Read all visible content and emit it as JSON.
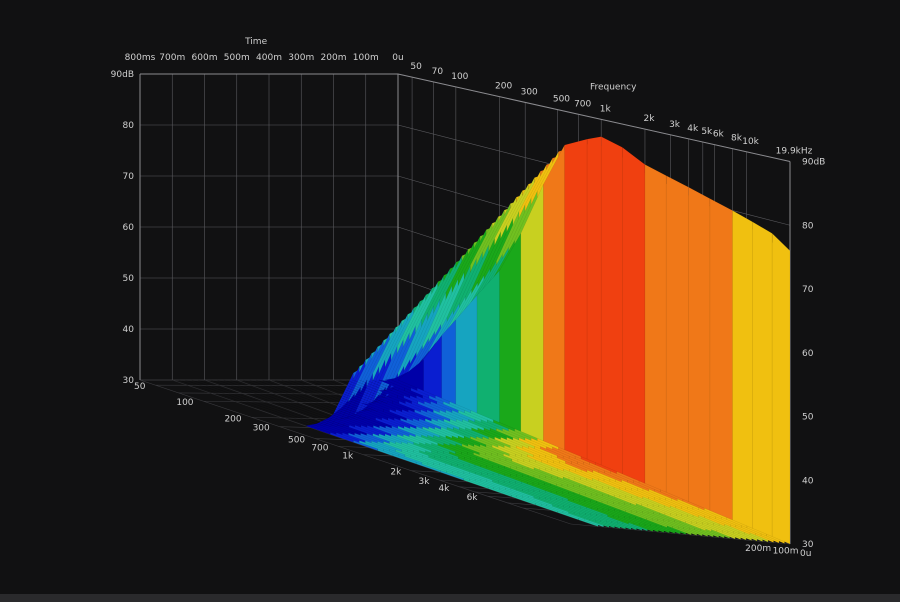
{
  "chart_data": {
    "type": "waterfall-3d",
    "title": "",
    "axes": {
      "time": {
        "label": "Time",
        "ticks": [
          "800ms",
          "700m",
          "600m",
          "500m",
          "400m",
          "300m",
          "200m",
          "100m",
          "0u"
        ]
      },
      "frequency": {
        "label": "Frequency",
        "back_ticks": [
          "50",
          "70",
          "100",
          "200",
          "300",
          "500",
          "700",
          "1k",
          "2k",
          "3k",
          "4k",
          "5k",
          "6k",
          "8k",
          "10k",
          "19.9kHz"
        ],
        "side_ticks": [
          "50",
          "100",
          "200",
          "300",
          "500",
          "700",
          "1k",
          "2k",
          "3k",
          "4k",
          "6k"
        ],
        "range_hz": [
          40,
          19900
        ]
      },
      "level": {
        "unit": "dB",
        "left_ticks": [
          "90dB",
          "80",
          "70",
          "60",
          "50",
          "40",
          "30"
        ],
        "right_ticks": [
          "90dB",
          "80",
          "70",
          "60",
          "50",
          "40",
          "30"
        ],
        "range_db": [
          30,
          90
        ]
      },
      "time_front_ticks": [
        "0u",
        "100m",
        "200m"
      ]
    },
    "slices_ms": [
      0,
      20,
      40,
      60,
      80,
      100,
      120,
      140,
      160,
      180,
      200,
      220,
      240,
      260,
      280,
      300,
      320,
      340,
      360,
      380,
      400,
      420,
      440,
      460,
      480,
      500,
      520,
      540,
      560,
      580,
      600,
      620,
      640,
      660,
      680,
      700
    ],
    "frequency_points_hz": [
      40,
      60,
      80,
      100,
      140,
      200,
      280,
      400,
      560,
      800,
      1000,
      1400,
      2000,
      2800,
      4000,
      5600,
      8000,
      11000,
      15000,
      19900
    ],
    "level_at_0ms_db": [
      30,
      36,
      42,
      46,
      52,
      58,
      66,
      76,
      84,
      86,
      87,
      86,
      84,
      83,
      82,
      81,
      80,
      79,
      78,
      76
    ],
    "decay_db_per_100ms": 8,
    "color_bands": {
      "30": "#0000a8",
      "35": "#0a1ed0",
      "40": "#1060d8",
      "45": "#16a4c0",
      "50": "#20c0a0",
      "55": "#10b070",
      "60": "#1aa81a",
      "65": "#70c020",
      "70": "#c8d020",
      "75": "#f0c010",
      "80": "#f07818",
      "85": "#f04010",
      "90": "#e00000"
    }
  }
}
